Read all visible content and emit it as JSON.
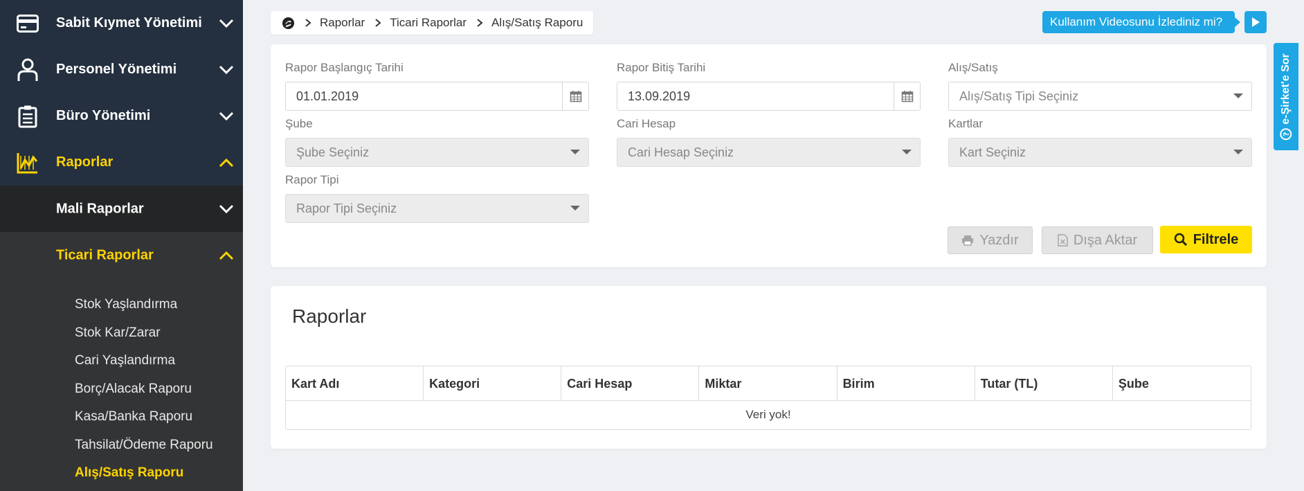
{
  "sidebar": {
    "main_items": [
      {
        "label": "Sabit Kıymet Yönetimi",
        "icon": "credit-card-icon"
      },
      {
        "label": "Personel Yönetimi",
        "icon": "user-icon"
      },
      {
        "label": "Büro Yönetimi",
        "icon": "clipboard-icon"
      },
      {
        "label": "Raporlar",
        "icon": "chart-icon"
      }
    ],
    "sub_items": [
      {
        "label": "Mali Raporlar"
      },
      {
        "label": "Ticari Raporlar"
      }
    ],
    "leaf_items": [
      "Stok Yaşlandırma",
      "Stok Kar/Zarar",
      "Cari Yaşlandırma",
      "Borç/Alacak Raporu",
      "Kasa/Banka Raporu",
      "Tahsilat/Ödeme Raporu",
      "Alış/Satış Raporu"
    ],
    "colors": {
      "active": "#ffd400",
      "main_bg": "#24303f",
      "sub_bg": "#242526",
      "leaf_bg": "#333436"
    }
  },
  "breadcrumb": [
    "Raporlar",
    "Ticari Raporlar",
    "Alış/Satış Raporu"
  ],
  "video_prompt": "Kullanım Videosunu İzlediniz mi?",
  "side_tab": "e-Şirket'e Sor",
  "filters": {
    "start_date": {
      "label": "Rapor Başlangıç Tarihi",
      "value": "01.01.2019"
    },
    "end_date": {
      "label": "Rapor Bitiş Tarihi",
      "value": "13.09.2019"
    },
    "type": {
      "label": "Alış/Satış",
      "placeholder": "Alış/Satış Tipi Seçiniz"
    },
    "branch": {
      "label": "Şube",
      "placeholder": "Şube Seçiniz"
    },
    "account": {
      "label": "Cari Hesap",
      "placeholder": "Cari Hesap Seçiniz"
    },
    "cards": {
      "label": "Kartlar",
      "placeholder": "Kart Seçiniz"
    },
    "report_type": {
      "label": "Rapor Tipi",
      "placeholder": "Rapor Tipi Seçiniz"
    }
  },
  "actions": {
    "print": "Yazdır",
    "export": "Dışa Aktar",
    "filter": "Filtrele"
  },
  "report": {
    "title": "Raporlar",
    "columns": [
      "Kart Adı",
      "Kategori",
      "Cari Hesap",
      "Miktar",
      "Birim",
      "Tutar (TL)",
      "Şube"
    ],
    "empty": "Veri yok!"
  },
  "accent_colors": {
    "info": "#1ea7e4",
    "primary": "#ffe000"
  }
}
